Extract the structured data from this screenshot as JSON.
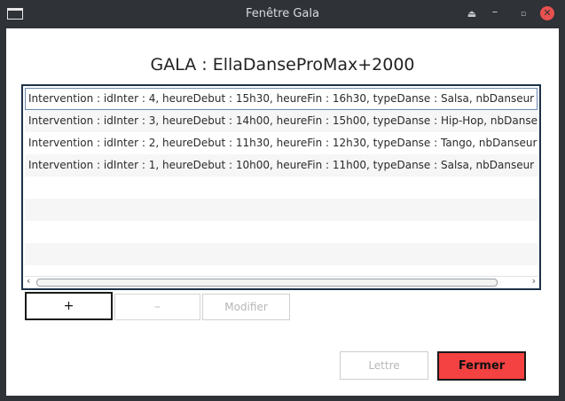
{
  "window": {
    "title": "Fenêtre Gala",
    "controls": {
      "eject": "⏏",
      "minimize": "–",
      "maximize": "▫",
      "close": "✕"
    }
  },
  "heading": "GALA : EllaDanseProMax+2000",
  "interventions": [
    "Intervention : idInter : 4, heureDebut : 15h30, heureFin : 16h30, typeDanse : Salsa, nbDanseur",
    "Intervention : idInter : 3, heureDebut : 14h00, heureFin : 15h00, typeDanse : Hip-Hop, nbDanse",
    "Intervention : idInter : 2, heureDebut : 11h30, heureFin : 12h30, typeDanse : Tango, nbDanseur",
    "Intervention : idInter : 1, heureDebut : 10h00, heureFin : 11h00, typeDanse : Salsa, nbDanseur"
  ],
  "scrollbar": {
    "left_arrow": "‹",
    "right_arrow": "›"
  },
  "buttons": {
    "add": "+",
    "remove": "–",
    "modify": "Modifier",
    "letter": "Lettre",
    "close": "Fermer"
  },
  "colors": {
    "titlebar": "#2f3237",
    "close_button": "#f44141",
    "list_border": "#1c3147"
  }
}
